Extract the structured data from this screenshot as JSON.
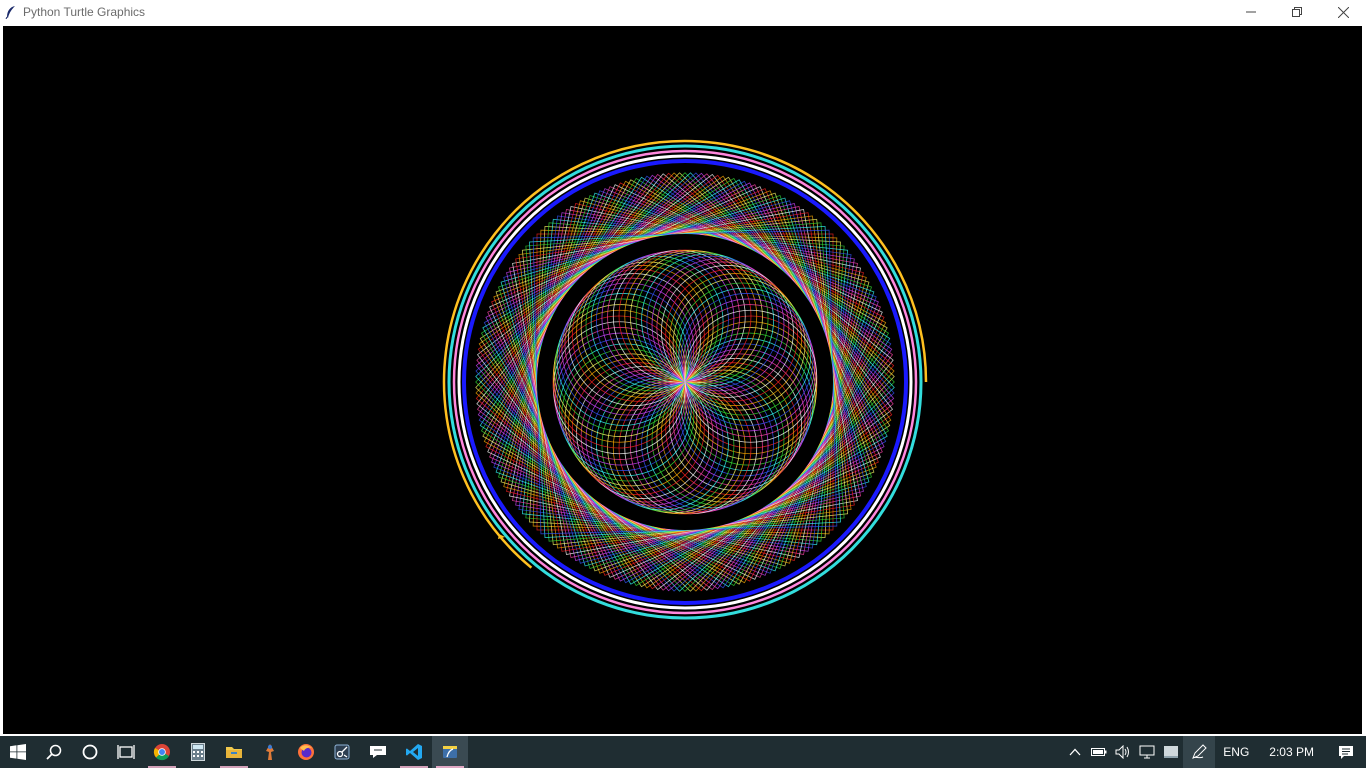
{
  "window": {
    "title": "Python Turtle Graphics",
    "app_icon": "feather-icon",
    "controls": {
      "minimize_icon": "minimize-icon",
      "maximize_icon": "restore-icon",
      "close_icon": "close-icon"
    }
  },
  "canvas": {
    "background": "#000000",
    "drawing": "turtle-spirograph"
  },
  "taskbar": {
    "pinned": [
      {
        "name": "start-button",
        "icon": "windows-logo-icon"
      },
      {
        "name": "search-button",
        "icon": "search-icon"
      },
      {
        "name": "cortana-button",
        "icon": "cortana-circle-icon"
      },
      {
        "name": "task-view-button",
        "icon": "task-view-icon"
      },
      {
        "name": "chrome-button",
        "icon": "chrome-icon"
      },
      {
        "name": "calculator-button",
        "icon": "calculator-icon"
      },
      {
        "name": "file-explorer-button",
        "icon": "folder-icon"
      },
      {
        "name": "paint-button",
        "icon": "paint-icon"
      },
      {
        "name": "firefox-button",
        "icon": "firefox-icon"
      },
      {
        "name": "snipping-button",
        "icon": "snipping-icon"
      },
      {
        "name": "feedback-button",
        "icon": "feedback-icon"
      },
      {
        "name": "vscode-button",
        "icon": "vscode-icon"
      },
      {
        "name": "python-button",
        "icon": "python-feather-icon"
      }
    ],
    "tray": {
      "language": "ENG",
      "time": "2:03 PM"
    }
  },
  "colors": {
    "taskbar": "#1f2d32",
    "running_indicator": "#d2a0b8"
  }
}
